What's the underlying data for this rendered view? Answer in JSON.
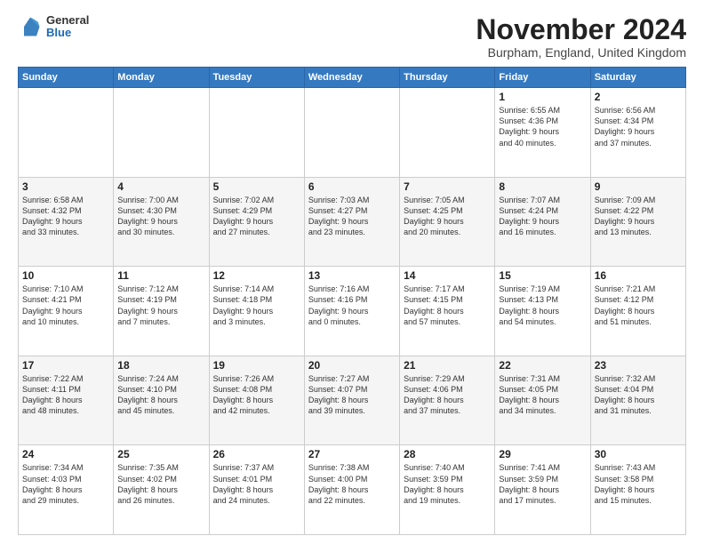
{
  "header": {
    "logo_general": "General",
    "logo_blue": "Blue",
    "month_title": "November 2024",
    "location": "Burpham, England, United Kingdom"
  },
  "weekdays": [
    "Sunday",
    "Monday",
    "Tuesday",
    "Wednesday",
    "Thursday",
    "Friday",
    "Saturday"
  ],
  "weeks": [
    [
      {
        "day": "",
        "info": ""
      },
      {
        "day": "",
        "info": ""
      },
      {
        "day": "",
        "info": ""
      },
      {
        "day": "",
        "info": ""
      },
      {
        "day": "",
        "info": ""
      },
      {
        "day": "1",
        "info": "Sunrise: 6:55 AM\nSunset: 4:36 PM\nDaylight: 9 hours\nand 40 minutes."
      },
      {
        "day": "2",
        "info": "Sunrise: 6:56 AM\nSunset: 4:34 PM\nDaylight: 9 hours\nand 37 minutes."
      }
    ],
    [
      {
        "day": "3",
        "info": "Sunrise: 6:58 AM\nSunset: 4:32 PM\nDaylight: 9 hours\nand 33 minutes."
      },
      {
        "day": "4",
        "info": "Sunrise: 7:00 AM\nSunset: 4:30 PM\nDaylight: 9 hours\nand 30 minutes."
      },
      {
        "day": "5",
        "info": "Sunrise: 7:02 AM\nSunset: 4:29 PM\nDaylight: 9 hours\nand 27 minutes."
      },
      {
        "day": "6",
        "info": "Sunrise: 7:03 AM\nSunset: 4:27 PM\nDaylight: 9 hours\nand 23 minutes."
      },
      {
        "day": "7",
        "info": "Sunrise: 7:05 AM\nSunset: 4:25 PM\nDaylight: 9 hours\nand 20 minutes."
      },
      {
        "day": "8",
        "info": "Sunrise: 7:07 AM\nSunset: 4:24 PM\nDaylight: 9 hours\nand 16 minutes."
      },
      {
        "day": "9",
        "info": "Sunrise: 7:09 AM\nSunset: 4:22 PM\nDaylight: 9 hours\nand 13 minutes."
      }
    ],
    [
      {
        "day": "10",
        "info": "Sunrise: 7:10 AM\nSunset: 4:21 PM\nDaylight: 9 hours\nand 10 minutes."
      },
      {
        "day": "11",
        "info": "Sunrise: 7:12 AM\nSunset: 4:19 PM\nDaylight: 9 hours\nand 7 minutes."
      },
      {
        "day": "12",
        "info": "Sunrise: 7:14 AM\nSunset: 4:18 PM\nDaylight: 9 hours\nand 3 minutes."
      },
      {
        "day": "13",
        "info": "Sunrise: 7:16 AM\nSunset: 4:16 PM\nDaylight: 9 hours\nand 0 minutes."
      },
      {
        "day": "14",
        "info": "Sunrise: 7:17 AM\nSunset: 4:15 PM\nDaylight: 8 hours\nand 57 minutes."
      },
      {
        "day": "15",
        "info": "Sunrise: 7:19 AM\nSunset: 4:13 PM\nDaylight: 8 hours\nand 54 minutes."
      },
      {
        "day": "16",
        "info": "Sunrise: 7:21 AM\nSunset: 4:12 PM\nDaylight: 8 hours\nand 51 minutes."
      }
    ],
    [
      {
        "day": "17",
        "info": "Sunrise: 7:22 AM\nSunset: 4:11 PM\nDaylight: 8 hours\nand 48 minutes."
      },
      {
        "day": "18",
        "info": "Sunrise: 7:24 AM\nSunset: 4:10 PM\nDaylight: 8 hours\nand 45 minutes."
      },
      {
        "day": "19",
        "info": "Sunrise: 7:26 AM\nSunset: 4:08 PM\nDaylight: 8 hours\nand 42 minutes."
      },
      {
        "day": "20",
        "info": "Sunrise: 7:27 AM\nSunset: 4:07 PM\nDaylight: 8 hours\nand 39 minutes."
      },
      {
        "day": "21",
        "info": "Sunrise: 7:29 AM\nSunset: 4:06 PM\nDaylight: 8 hours\nand 37 minutes."
      },
      {
        "day": "22",
        "info": "Sunrise: 7:31 AM\nSunset: 4:05 PM\nDaylight: 8 hours\nand 34 minutes."
      },
      {
        "day": "23",
        "info": "Sunrise: 7:32 AM\nSunset: 4:04 PM\nDaylight: 8 hours\nand 31 minutes."
      }
    ],
    [
      {
        "day": "24",
        "info": "Sunrise: 7:34 AM\nSunset: 4:03 PM\nDaylight: 8 hours\nand 29 minutes."
      },
      {
        "day": "25",
        "info": "Sunrise: 7:35 AM\nSunset: 4:02 PM\nDaylight: 8 hours\nand 26 minutes."
      },
      {
        "day": "26",
        "info": "Sunrise: 7:37 AM\nSunset: 4:01 PM\nDaylight: 8 hours\nand 24 minutes."
      },
      {
        "day": "27",
        "info": "Sunrise: 7:38 AM\nSunset: 4:00 PM\nDaylight: 8 hours\nand 22 minutes."
      },
      {
        "day": "28",
        "info": "Sunrise: 7:40 AM\nSunset: 3:59 PM\nDaylight: 8 hours\nand 19 minutes."
      },
      {
        "day": "29",
        "info": "Sunrise: 7:41 AM\nSunset: 3:59 PM\nDaylight: 8 hours\nand 17 minutes."
      },
      {
        "day": "30",
        "info": "Sunrise: 7:43 AM\nSunset: 3:58 PM\nDaylight: 8 hours\nand 15 minutes."
      }
    ]
  ]
}
